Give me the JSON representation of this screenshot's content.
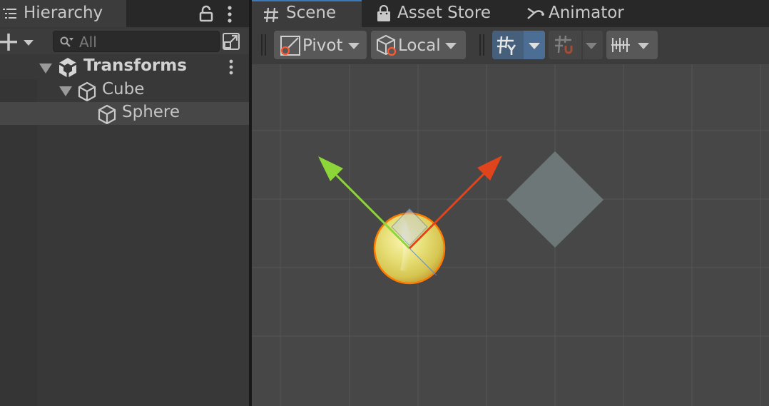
{
  "hierarchy": {
    "tab_label": "Hierarchy",
    "search_placeholder": "All",
    "rows": [
      {
        "label": "Transforms",
        "type": "scene"
      },
      {
        "label": "Cube",
        "type": "gameobject"
      },
      {
        "label": "Sphere",
        "type": "gameobject",
        "selected": true
      }
    ]
  },
  "scene_view": {
    "tabs": [
      {
        "label": "Scene",
        "icon": "grid-icon",
        "active": true
      },
      {
        "label": "Asset Store",
        "icon": "shopping-bag-icon"
      },
      {
        "label": "Animator",
        "icon": "animator-icon"
      }
    ],
    "toolbar": {
      "pivot_label": "Pivot",
      "local_label": "Local"
    }
  },
  "colors": {
    "accent_blue": "#3a79bb",
    "x_axis": "#e0441c",
    "y_axis": "#8cd63a",
    "sphere": "#e8e07a",
    "cube": "#6e7777"
  }
}
